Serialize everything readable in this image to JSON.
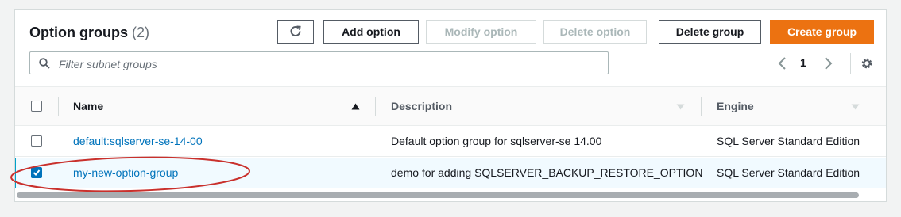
{
  "header": {
    "title": "Option groups",
    "count": "(2)"
  },
  "toolbar": {
    "refresh_icon": "refresh-icon",
    "add_option": "Add option",
    "modify_option": "Modify option",
    "delete_option": "Delete option",
    "delete_group": "Delete group",
    "create_group": "Create group"
  },
  "search": {
    "placeholder": "Filter subnet groups",
    "value": "",
    "icon": "search-icon"
  },
  "pagination": {
    "page": "1"
  },
  "table": {
    "columns": [
      "Name",
      "Description",
      "Engine"
    ],
    "sort": {
      "column": "Name",
      "direction": "ascending"
    },
    "rows": [
      {
        "name": "default:sqlserver-se-14-00",
        "description": "Default option group for sqlserver-se 14.00",
        "engine": "SQL Server Standard Edition",
        "selected": false
      },
      {
        "name": "my-new-option-group",
        "description": "demo for adding SQLSERVER_BACKUP_RESTORE_OPTION",
        "engine": "SQL Server Standard Edition",
        "selected": true
      }
    ]
  },
  "colors": {
    "primary": "#ec7211",
    "link": "#0073bb",
    "selected_border": "#00a1c9",
    "annotation": "#c9302c"
  }
}
